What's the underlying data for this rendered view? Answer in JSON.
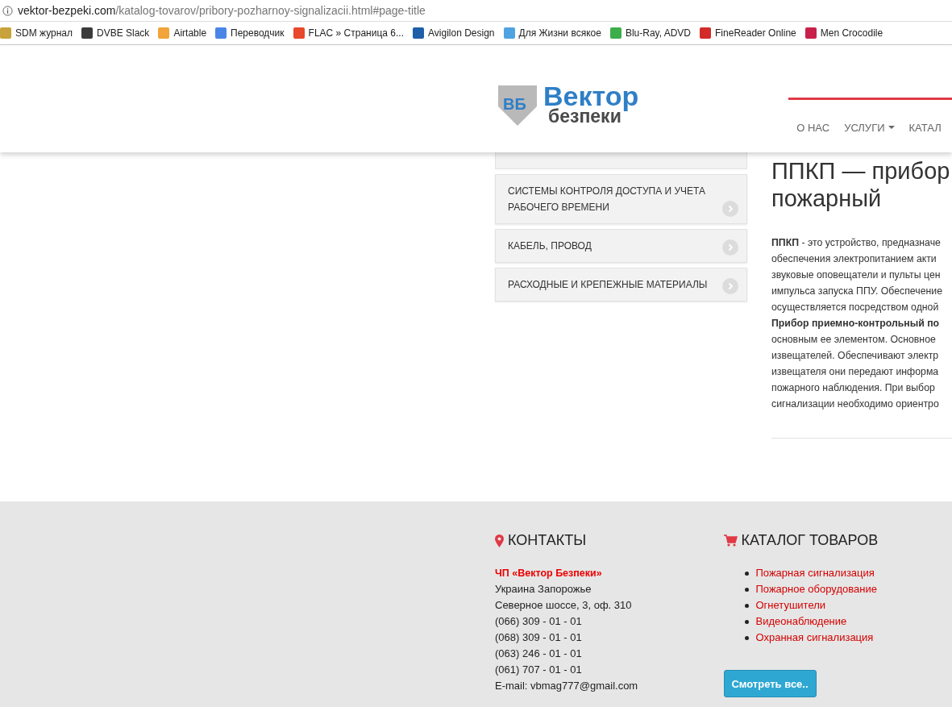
{
  "browser": {
    "url_host": "vektor-bezpeki.com",
    "url_path": "/katalog-tovarov/pribory-pozharnoy-signalizacii.html#page-title",
    "bookmarks": [
      {
        "label": "SDM журнал",
        "color": "#c8a23a"
      },
      {
        "label": "DVBE Slack",
        "color": "#3b3b3b"
      },
      {
        "label": "Airtable",
        "color": "#f2a33a"
      },
      {
        "label": "Переводчик",
        "color": "#4a86e8"
      },
      {
        "label": "FLAC » Страница 6...",
        "color": "#e8482b"
      },
      {
        "label": "Avigilon Design",
        "color": "#1f5fa8"
      },
      {
        "label": "Для Жизни всякое",
        "color": "#4fa3e0"
      },
      {
        "label": "Blu-Ray, ADVD",
        "color": "#3cae4a"
      },
      {
        "label": "FineReader Online",
        "color": "#d32a2a"
      },
      {
        "label": "Men Crocodile",
        "color": "#c8204a"
      }
    ]
  },
  "header": {
    "logo": {
      "mark": "ВБ",
      "title": "Вектор",
      "subtitle": "безпеки"
    },
    "nav": [
      {
        "label": "О НАС",
        "dropdown": false
      },
      {
        "label": "УСЛУГИ",
        "dropdown": true
      },
      {
        "label": "КАТАЛ",
        "dropdown": false
      }
    ]
  },
  "sidebar": {
    "items": [
      {
        "label": "СИСТЕМЫ КОНТРОЛЯ ДОСТУПА И УЧЕТА РАБОЧЕГО ВРЕМЕНИ"
      },
      {
        "label": "КАБЕЛЬ, ПРОВОД"
      },
      {
        "label": "РАСХОДНЫЕ И КРЕПЕЖНЫЕ МАТЕРИАЛЫ"
      }
    ]
  },
  "article": {
    "title_lines": [
      "ППКП — прибор",
      "пожарный"
    ],
    "lines": [
      "**ППКП** - это устройство, предназначе",
      "обеспечения электропитанием акти",
      "звуковые оповещатели и пульты цен",
      "импульса запуска ППУ. Обеспечение",
      "осуществляется посредством одной",
      "**Прибор приемно-контрольный  по**",
      "основным ее  элементом. Основное",
      "извещателей. Обеспечивают электр",
      "извещателя они передают  информа",
      "пожарного наблюдения.  При выбор",
      "сигнализации необходимо ориентро"
    ]
  },
  "footer": {
    "contacts": {
      "heading": "КОНТАКТЫ",
      "company": "ЧП «Вектор Безпеки»",
      "lines": [
        "Украина Запорожье",
        "Северное шоссе, 3, оф. 310",
        "(066) 309 - 01 - 01",
        "(068) 309 - 01 - 01",
        "(063) 246 - 01 - 01",
        "(061) 707 - 01 - 01",
        "E-mail: vbmag777@gmail.com"
      ]
    },
    "catalog": {
      "heading": "КАТАЛОГ ТОВАРОВ",
      "links": [
        "Пожарная сигнализация",
        "Пожарное оборудование",
        "Огнетушители",
        "Видеонаблюдение",
        "Охранная сигнализация"
      ],
      "button": "Смотреть все.."
    }
  }
}
